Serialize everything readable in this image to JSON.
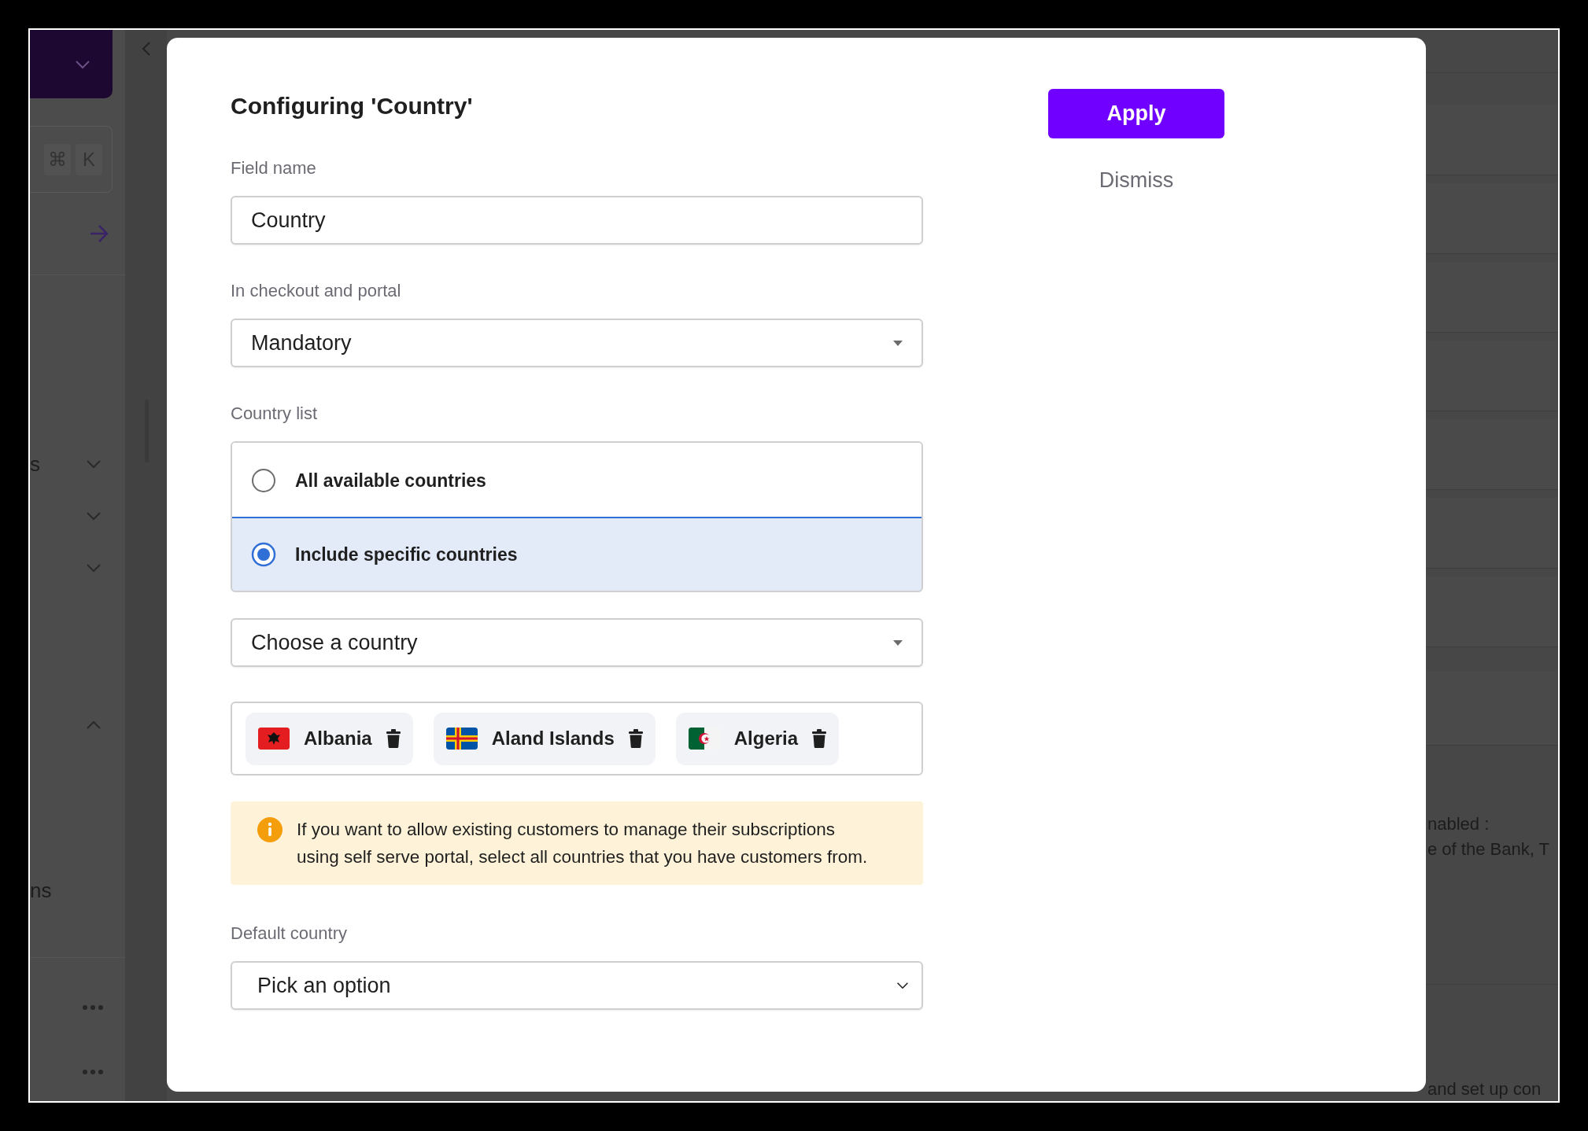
{
  "background": {
    "sidebar": {
      "keys": [
        "⌘",
        "K"
      ],
      "sections": [
        {
          "label": "s",
          "expanded": false
        },
        {
          "expanded": false
        },
        {
          "expanded": false
        },
        {
          "expanded": true
        }
      ],
      "footer_text": "ns"
    },
    "main_texts": [
      "nabled :",
      "e of the Bank, T",
      "and set up con"
    ]
  },
  "modal": {
    "title": "Configuring 'Country'",
    "apply": "Apply",
    "dismiss": "Dismiss",
    "field_name": {
      "label": "Field name",
      "value": "Country"
    },
    "checkout_portal": {
      "label": "In checkout and portal",
      "value": "Mandatory"
    },
    "country_list": {
      "label": "Country list",
      "options": [
        {
          "label": "All available countries",
          "selected": false
        },
        {
          "label": "Include specific countries",
          "selected": true
        }
      ]
    },
    "country_picker": {
      "placeholder": "Choose a country"
    },
    "selected_countries": [
      {
        "name": "Albania",
        "kind": "albania"
      },
      {
        "name": "Aland Islands",
        "kind": "aland"
      },
      {
        "name": "Algeria",
        "kind": "algeria"
      }
    ],
    "notice": "If you want to allow existing customers to manage their subscriptions using self serve portal, select all countries that you have customers from.",
    "default_country": {
      "label": "Default country",
      "placeholder": "Pick an option"
    }
  }
}
